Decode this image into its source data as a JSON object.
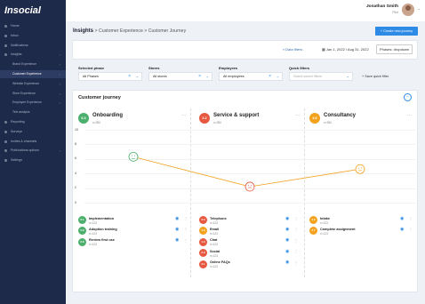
{
  "app": {
    "logo": "Insocial"
  },
  "sidebar": {
    "items": [
      {
        "label": "Home",
        "has_chevron": false
      },
      {
        "label": "Inbox",
        "has_chevron": false
      },
      {
        "label": "Notifications",
        "has_chevron": false
      },
      {
        "label": "Insights",
        "has_chevron": true
      },
      {
        "label": "Brand Experience",
        "has_chevron": true,
        "sub": true
      },
      {
        "label": "Customer Experience",
        "has_chevron": true,
        "sub": true,
        "active": true
      },
      {
        "label": "Website Experience",
        "has_chevron": true,
        "sub": true
      },
      {
        "label": "Store Experience",
        "has_chevron": true,
        "sub": true
      },
      {
        "label": "Employee Experience",
        "has_chevron": true,
        "sub": true
      },
      {
        "label": "Text analysis",
        "has_chevron": false,
        "sub": true
      },
      {
        "label": "Reporting",
        "has_chevron": false
      },
      {
        "label": "Surveys",
        "has_chevron": false
      },
      {
        "label": "Invites & channels",
        "has_chevron": false
      },
      {
        "label": "Publications options",
        "has_chevron": true
      },
      {
        "label": "Settings",
        "has_chevron": false
      }
    ]
  },
  "user": {
    "name": "Jonathan Smith",
    "role": "Pilot",
    "caret": "⌄"
  },
  "breadcrumb": {
    "root": "Insights",
    "sep": ">",
    "level2": "Customer Experience",
    "level3": "Customer Journey"
  },
  "header": {
    "create_button": "+ Create new journey"
  },
  "filterbar": {
    "data_filters": "Data filters",
    "date_range": "Jan 1, 2022 / Aug 31, 2022",
    "phase_select": "Phases: dropdown"
  },
  "filters": [
    {
      "label": "Selected phase",
      "value": "All Phases",
      "placeholder": false
    },
    {
      "label": "Stores",
      "value": "All stores",
      "placeholder": false
    },
    {
      "label": "Employees",
      "value": "All employees",
      "placeholder": false
    },
    {
      "label": "Quick filters",
      "value": "Select saved filters",
      "placeholder": true
    }
  ],
  "save_quick_filter": "+ Save quick filter",
  "panel": {
    "title": "Customer journey",
    "collapse_glyph": "−"
  },
  "phases": [
    {
      "score": "6.3",
      "name": "Onboarding",
      "n": "n=380",
      "color": "#4caf6e",
      "touchpoints": [
        {
          "score": "6.1",
          "name": "Implementation",
          "n": "n=123",
          "color": "#4caf6e"
        },
        {
          "score": "5.9",
          "name": "Adoption training",
          "n": "n=123",
          "color": "#4caf6e"
        },
        {
          "score": "6.8",
          "name": "Review first use",
          "n": "n=123",
          "color": "#4caf6e"
        }
      ]
    },
    {
      "score": "2.2",
      "name": "Service & support",
      "n": "n=380",
      "color": "#e8573f",
      "touchpoints": [
        {
          "score": "3.3",
          "name": "Telephone",
          "n": "n=123",
          "color": "#e8573f"
        },
        {
          "score": "4.9",
          "name": "Email",
          "n": "n=123",
          "color": "#f3a21e"
        },
        {
          "score": "1.3",
          "name": "Chat",
          "n": "n=123",
          "color": "#e8573f"
        },
        {
          "score": "2.9",
          "name": "Social",
          "n": "n=123",
          "color": "#e8573f"
        },
        {
          "score": "3.1",
          "name": "Online FAQs",
          "n": "n=123",
          "color": "#e8573f"
        }
      ]
    },
    {
      "score": "4.6",
      "name": "Consultancy",
      "n": "n=380",
      "color": "#f3a21e",
      "touchpoints": [
        {
          "score": "4.3",
          "name": "Intake",
          "n": "n=123",
          "color": "#f3a21e"
        },
        {
          "score": "4.7",
          "name": "Complete assignment",
          "n": "n=123",
          "color": "#f3a21e"
        }
      ]
    }
  ],
  "chart_data": {
    "type": "line",
    "categories": [
      "Onboarding",
      "Service & support",
      "Consultancy"
    ],
    "values": [
      6.3,
      2.2,
      4.6
    ],
    "ylim": [
      0,
      10
    ],
    "yticks": [
      "10",
      "8",
      "6",
      "4",
      "2",
      "0"
    ],
    "grid": true,
    "colors": [
      "#4caf6e",
      "#e8573f",
      "#f3a21e"
    ]
  }
}
